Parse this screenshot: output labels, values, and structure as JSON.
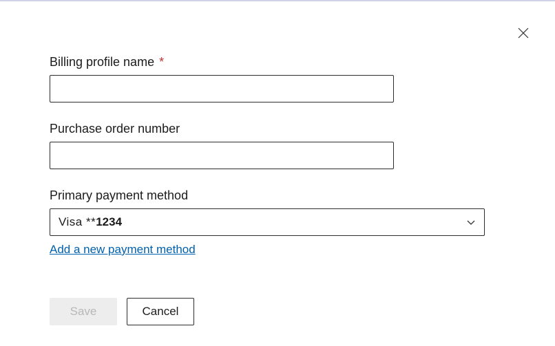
{
  "close": {
    "aria_label": "Close"
  },
  "form": {
    "billing_profile": {
      "label": "Billing profile name",
      "required_marker": "*",
      "value": ""
    },
    "purchase_order": {
      "label": "Purchase order number",
      "value": ""
    },
    "payment_method": {
      "label": "Primary payment method",
      "selected_prefix": "Visa **",
      "selected_digits": "1234",
      "add_link": "Add a new payment method"
    }
  },
  "buttons": {
    "save": "Save",
    "cancel": "Cancel"
  }
}
